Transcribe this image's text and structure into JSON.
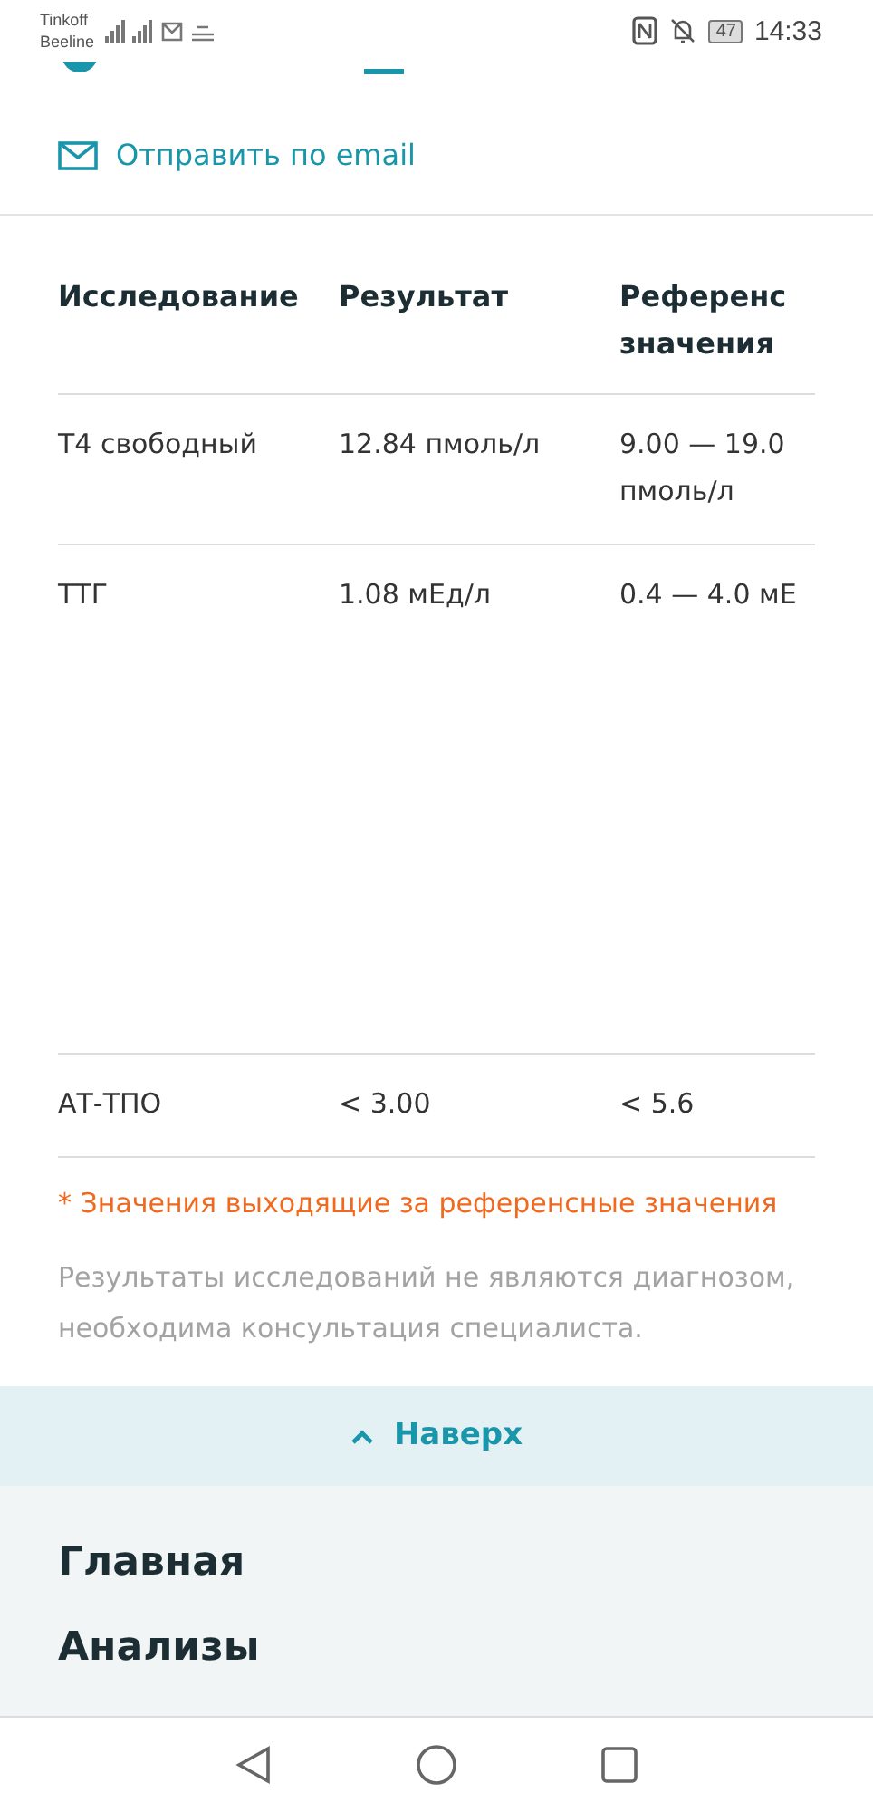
{
  "status_bar": {
    "carriers": [
      "Tinkoff",
      "Beeline"
    ],
    "battery": "47",
    "time": "14:33"
  },
  "actions": [
    {
      "label": "Отправить по email",
      "kind": "email"
    }
  ],
  "table": {
    "columns": [
      "Исследование",
      "Результат",
      "Референс значения"
    ],
    "rows": [
      {
        "cells": [
          "Т4 свободный",
          "12.84 пмоль/л",
          "9.00 — 19.0 пмоль/л"
        ],
        "tall": false
      },
      {
        "cells": [
          "ТТГ",
          "1.08 мЕд/л",
          "0.4 — 4.0 мЕ"
        ],
        "tall": true
      },
      {
        "cells": [
          "АТ-ТПО",
          "< 3.00",
          "< 5.6"
        ],
        "tall": false
      }
    ]
  },
  "note": "* Значения выходящие за референсные значения",
  "disclaimer": "Результаты исследований не являются диагнозом, необходима консультация специалиста.",
  "back_to_top": "Наверх",
  "footer_menu": [
    "Главная",
    "Анализы"
  ]
}
